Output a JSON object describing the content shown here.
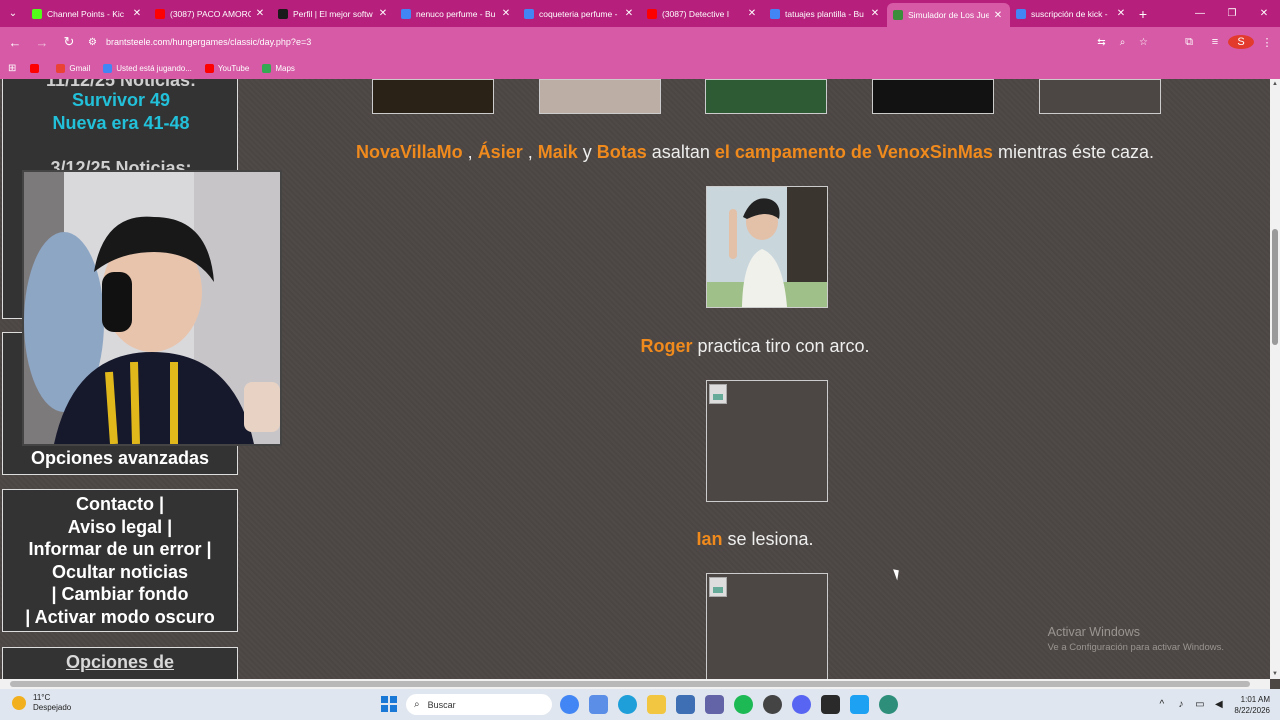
{
  "browser": {
    "tabs": [
      {
        "title": "Channel Points - Kic",
        "color": "#53fc18"
      },
      {
        "title": "(3087) PACO AMORC",
        "color": "#ff0000"
      },
      {
        "title": "Perfil | El mejor softw",
        "color": "#1a1a1a"
      },
      {
        "title": "nenuco perfume - Bu",
        "color": "#4285f4"
      },
      {
        "title": "coqueteria perfume -",
        "color": "#4285f4"
      },
      {
        "title": "(3087) Detective I",
        "color": "#ff0000"
      },
      {
        "title": "tatuajes plantilla - Bu",
        "color": "#4285f4"
      },
      {
        "title": "Simulador de Los Jue",
        "color": "#3c8d3c"
      },
      {
        "title": "suscripción de kick -",
        "color": "#4285f4"
      }
    ],
    "url": "brantsteele.com/hungergames/classic/day.php?e=3",
    "bookmarks": [
      {
        "label": "Gmail",
        "color": "#ea4335"
      },
      {
        "label": "Usted está jugando...",
        "color": "#4285f4"
      },
      {
        "label": "YouTube",
        "color": "#ff0000"
      },
      {
        "label": "Maps",
        "color": "#34a853"
      }
    ],
    "profile_initial": "S"
  },
  "sidebar": {
    "news_partial": "11/12/25 Noticias:",
    "news_link_1": "Survivor 49",
    "news_link_2": "Nueva era 41-48",
    "news_head_2": "3/12/25 Noticias:",
    "advanced_options": "Opciones avanzadas",
    "links": [
      "Contacto |",
      "Aviso legal |",
      "Informar de un error |",
      "Ocultar noticias",
      "| Cambiar fondo",
      "| Activar modo oscuro"
    ],
    "localization": "Opciones de"
  },
  "events": [
    {
      "parts": [
        {
          "t": "NovaVillaMo",
          "hl": true
        },
        {
          "t": " , ",
          "hl": false
        },
        {
          "t": "Ásier",
          "hl": true
        },
        {
          "t": " , ",
          "hl": false
        },
        {
          "t": "Maik",
          "hl": true
        },
        {
          "t": " y ",
          "hl": false
        },
        {
          "t": "Botas",
          "hl": true
        },
        {
          "t": " asaltan ",
          "hl": false
        },
        {
          "t": "el campamento de VenoxSinMas",
          "hl": true
        },
        {
          "t": " mientras éste caza.",
          "hl": false
        }
      ]
    },
    {
      "parts": [
        {
          "t": "Roger",
          "hl": true
        },
        {
          "t": " practica tiro con arco.",
          "hl": false
        }
      ]
    },
    {
      "parts": [
        {
          "t": "Ian",
          "hl": true
        },
        {
          "t": " se lesiona.",
          "hl": false
        }
      ]
    }
  ],
  "watermark": {
    "line1": "Activar Windows",
    "line2": "Ve a Configuración para activar Windows."
  },
  "taskbar": {
    "temperature": "11°C",
    "weather": "Despejado",
    "search_placeholder": "Buscar",
    "time": "1:01 AM",
    "date": "8/22/2026"
  }
}
